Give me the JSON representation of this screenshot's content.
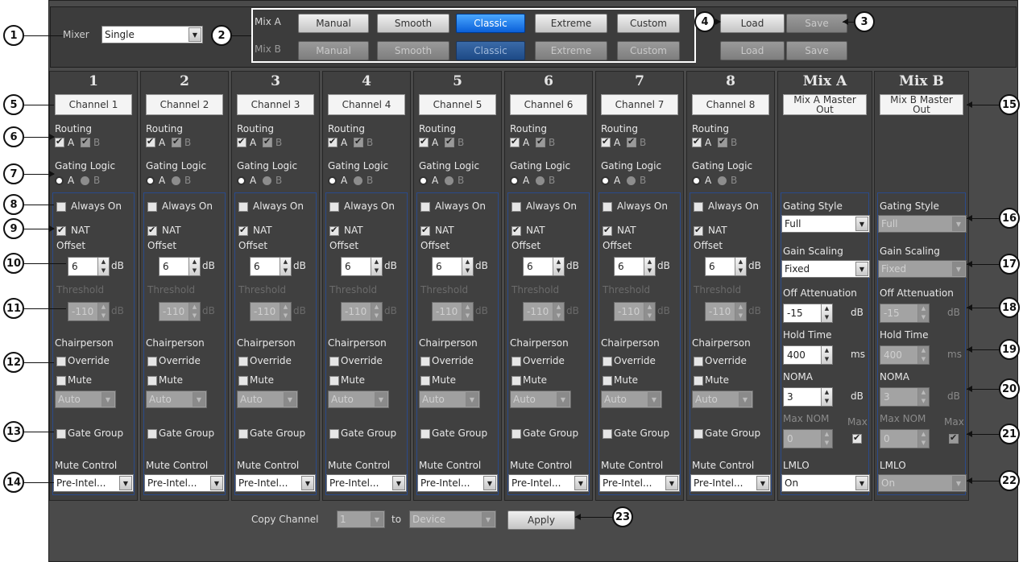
{
  "top": {
    "mixer_label": "Mixer",
    "mixer_value": "Single",
    "mixA_label": "Mix A",
    "mixB_label": "Mix B",
    "presets": [
      "Manual",
      "Smooth",
      "Classic",
      "Extreme",
      "Custom"
    ],
    "selected_preset": "Classic",
    "load": "Load",
    "save": "Save"
  },
  "channels": [
    {
      "num": "1",
      "name": "Channel 1"
    },
    {
      "num": "2",
      "name": "Channel 2"
    },
    {
      "num": "3",
      "name": "Channel 3"
    },
    {
      "num": "4",
      "name": "Channel 4"
    },
    {
      "num": "5",
      "name": "Channel 5"
    },
    {
      "num": "6",
      "name": "Channel 6"
    },
    {
      "num": "7",
      "name": "Channel 7"
    },
    {
      "num": "8",
      "name": "Channel 8"
    }
  ],
  "channel_labels": {
    "routing": "Routing",
    "a": "A",
    "b": "B",
    "gating_logic": "Gating Logic",
    "always_on": "Always On",
    "nat": "NAT",
    "offset": "Offset",
    "offset_value": "6",
    "offset_unit": "dB",
    "threshold": "Threshold",
    "threshold_value": "-110",
    "threshold_unit": "dB",
    "chairperson": "Chairperson",
    "override": "Override",
    "mute": "Mute",
    "chair_mode": "Auto",
    "gate_group": "Gate Group",
    "mute_control": "Mute Control",
    "mute_control_value": "Pre-Intel..."
  },
  "mixes": [
    {
      "title": "Mix A",
      "name": "Mix A Master Out",
      "gating_style_label": "Gating Style",
      "gating_style": "Full",
      "gain_scaling_label": "Gain Scaling",
      "gain_scaling": "Fixed",
      "off_atten_label": "Off Attenuation",
      "off_atten": "-15",
      "off_atten_unit": "dB",
      "hold_time_label": "Hold Time",
      "hold_time": "400",
      "hold_time_unit": "ms",
      "noma_label": "NOMA",
      "noma": "3",
      "noma_unit": "dB",
      "max_nom_label": "Max NOM",
      "max_label": "Max",
      "max_nom": "0",
      "lmlo_label": "LMLO",
      "lmlo": "On"
    },
    {
      "title": "Mix B",
      "name": "Mix B Master Out",
      "gating_style_label": "Gating Style",
      "gating_style": "Full",
      "gain_scaling_label": "Gain Scaling",
      "gain_scaling": "Fixed",
      "off_atten_label": "Off Attenuation",
      "off_atten": "-15",
      "off_atten_unit": "dB",
      "hold_time_label": "Hold Time",
      "hold_time": "400",
      "hold_time_unit": "ms",
      "noma_label": "NOMA",
      "noma": "3",
      "noma_unit": "dB",
      "max_nom_label": "Max NOM",
      "max_label": "Max",
      "max_nom": "0",
      "lmlo_label": "LMLO",
      "lmlo": "On"
    }
  ],
  "copy": {
    "label": "Copy Channel",
    "channel": "1",
    "to": "to",
    "target": "Device",
    "apply": "Apply"
  },
  "callouts": [
    "1",
    "2",
    "3",
    "4",
    "5",
    "6",
    "7",
    "8",
    "9",
    "10",
    "11",
    "12",
    "13",
    "14",
    "15",
    "16",
    "17",
    "18",
    "19",
    "20",
    "21",
    "22",
    "23"
  ]
}
